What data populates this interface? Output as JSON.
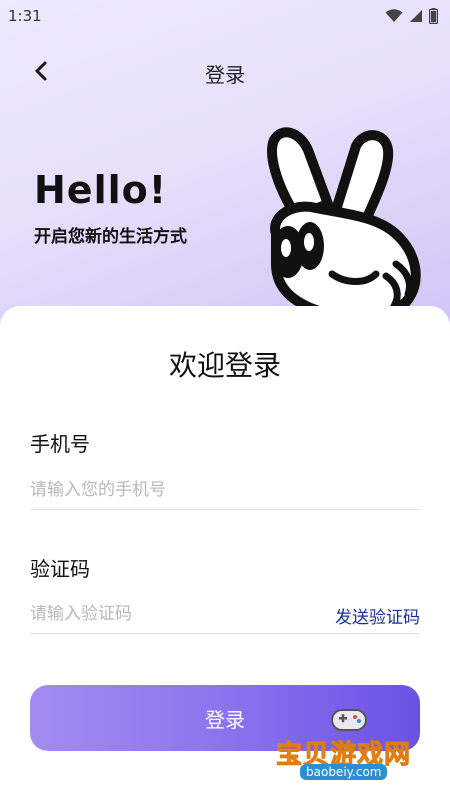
{
  "status_bar": {
    "time": "1:31"
  },
  "nav": {
    "title": "登录"
  },
  "hero": {
    "headline": "Hello!",
    "subtitle": "开启您新的生活方式"
  },
  "card": {
    "title": "欢迎登录",
    "phone": {
      "label": "手机号",
      "placeholder": "请输入您的手机号",
      "value": ""
    },
    "code": {
      "label": "验证码",
      "placeholder": "请输入验证码",
      "value": "",
      "send_label": "发送验证码"
    },
    "submit_label": "登录"
  },
  "watermark": {
    "text": "宝贝游戏网",
    "url": "baobeiy.com"
  },
  "colors": {
    "accent_start": "#a48bf1",
    "accent_end": "#6a52e6",
    "link": "#1a2f9e",
    "hero_bg": "#e6e0fb"
  },
  "icons": {
    "back": "chevron-left-icon",
    "wifi": "wifi-icon",
    "signal": "signal-icon",
    "battery": "battery-icon",
    "hand": "peace-hand-icon"
  }
}
